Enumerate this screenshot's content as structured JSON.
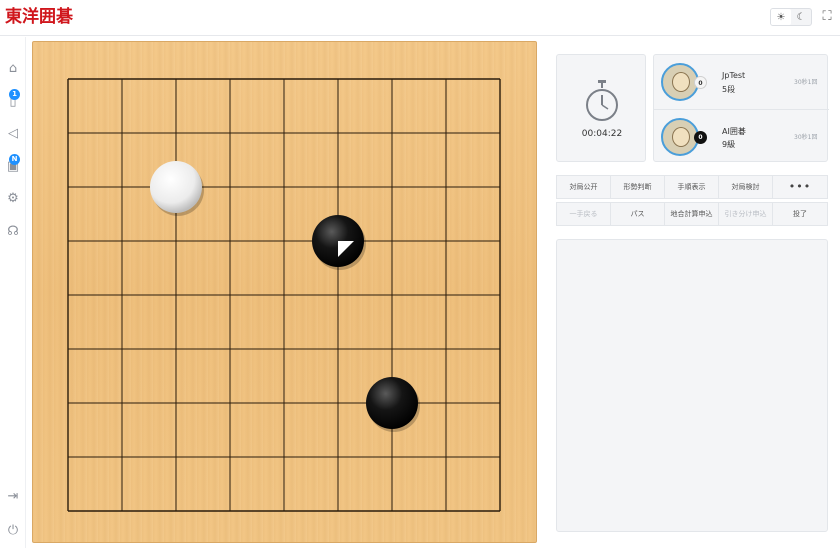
{
  "app": {
    "logo_text": "東洋囲碁"
  },
  "topbar": {
    "theme_light_icon": "sun-icon",
    "theme_dark_icon": "moon-icon",
    "fullscreen_icon": "fullscreen-icon"
  },
  "sidebar": {
    "items": [
      {
        "icon": "home-icon",
        "glyph": "⌂"
      },
      {
        "icon": "documents-icon",
        "glyph": "▯",
        "badge": "1"
      },
      {
        "icon": "megaphone-icon",
        "glyph": "◁"
      },
      {
        "icon": "gift-icon",
        "glyph": "▣",
        "badge": "N"
      },
      {
        "icon": "gear-icon",
        "glyph": "⚙"
      },
      {
        "icon": "headset-icon",
        "glyph": "☊"
      },
      {
        "icon": "logout-icon",
        "glyph": "⇥"
      },
      {
        "icon": "power-icon",
        "glyph": "⏻"
      }
    ]
  },
  "board": {
    "size": 9,
    "stones": [
      {
        "color": "white",
        "col": 2,
        "row": 2
      },
      {
        "color": "black",
        "col": 5,
        "row": 3,
        "last_move": true
      },
      {
        "color": "black",
        "col": 6,
        "row": 6
      }
    ]
  },
  "timer": {
    "elapsed": "00:04:22"
  },
  "players": [
    {
      "name": "JpTest",
      "rank": "5段",
      "stone": "white",
      "captures": "0",
      "time": "30秒1回"
    },
    {
      "name": "AI囲碁",
      "rank": "9級",
      "stone": "black",
      "captures": "0",
      "time": "30秒1回"
    }
  ],
  "actions": {
    "row1": [
      "対局公开",
      "形勢判断",
      "手順表示",
      "対局検討",
      "•••"
    ],
    "row2": [
      "一手戻る",
      "パス",
      "地合計算申込",
      "引き分け申込",
      "投了"
    ],
    "row2_disabled": [
      true,
      false,
      false,
      true,
      false
    ]
  },
  "colors": {
    "brand": "#d0161c",
    "accent": "#1e90ff",
    "board": "#f2c685"
  }
}
